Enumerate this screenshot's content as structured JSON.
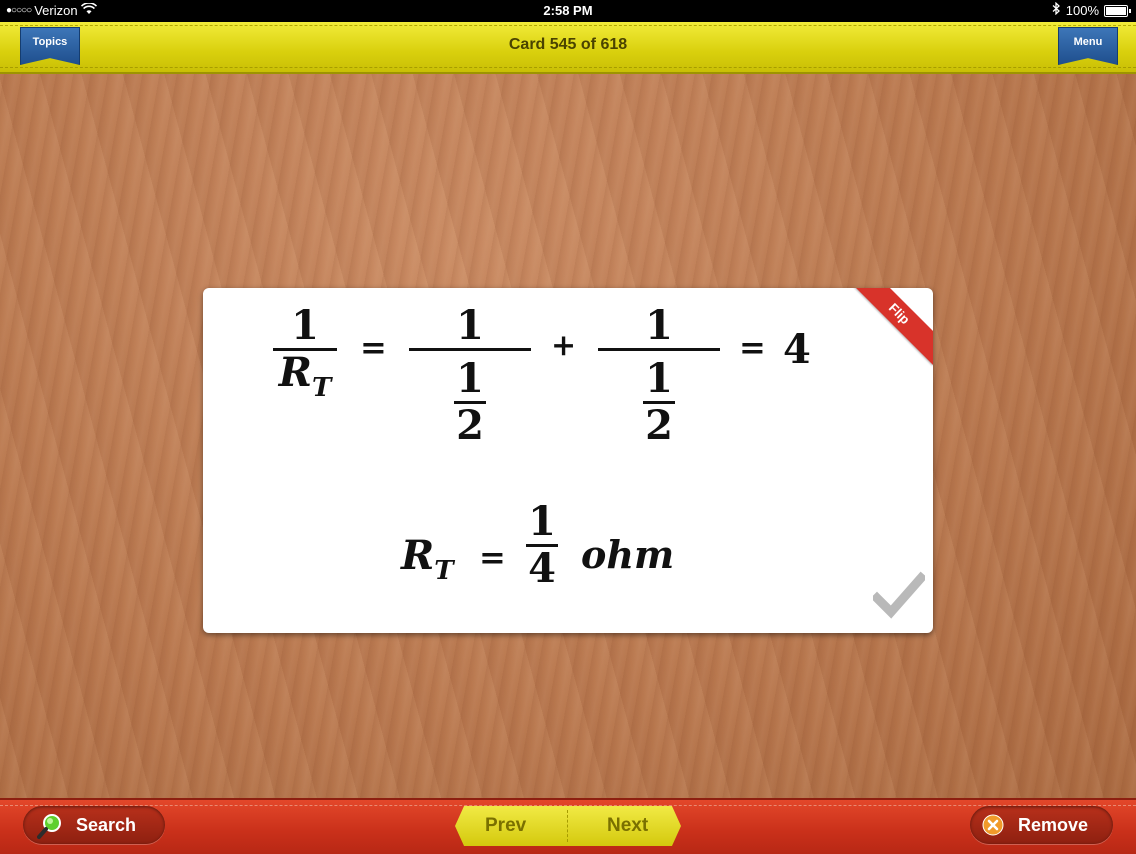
{
  "status_bar": {
    "carrier": "Verizon",
    "time": "2:58 PM",
    "battery": "100%"
  },
  "header": {
    "title": "Card 545 of 618",
    "topics_label": "Topics",
    "menu_label": "Menu"
  },
  "card": {
    "flip_label": "Flip",
    "equation1": {
      "lhs_num": "1",
      "lhs_den_main": "R",
      "lhs_den_sub": "T",
      "eq": "=",
      "term1_num": "1",
      "term1_den_num": "1",
      "term1_den_den": "2",
      "plus": "+",
      "term2_num": "1",
      "term2_den_num": "1",
      "term2_den_den": "2",
      "eq2": "=",
      "result": "4"
    },
    "equation2": {
      "lhs_main": "R",
      "lhs_sub": "T",
      "eq": "=",
      "num": "1",
      "den": "4",
      "unit": "ohm"
    }
  },
  "footer": {
    "search_label": "Search",
    "prev_label": "Prev",
    "next_label": "Next",
    "remove_label": "Remove"
  },
  "colors": {
    "top_bar": "#e3da1c",
    "bottom_bar": "#c9301a",
    "ribbon": "#2a5ea0",
    "flip_corner": "#d8332a"
  }
}
